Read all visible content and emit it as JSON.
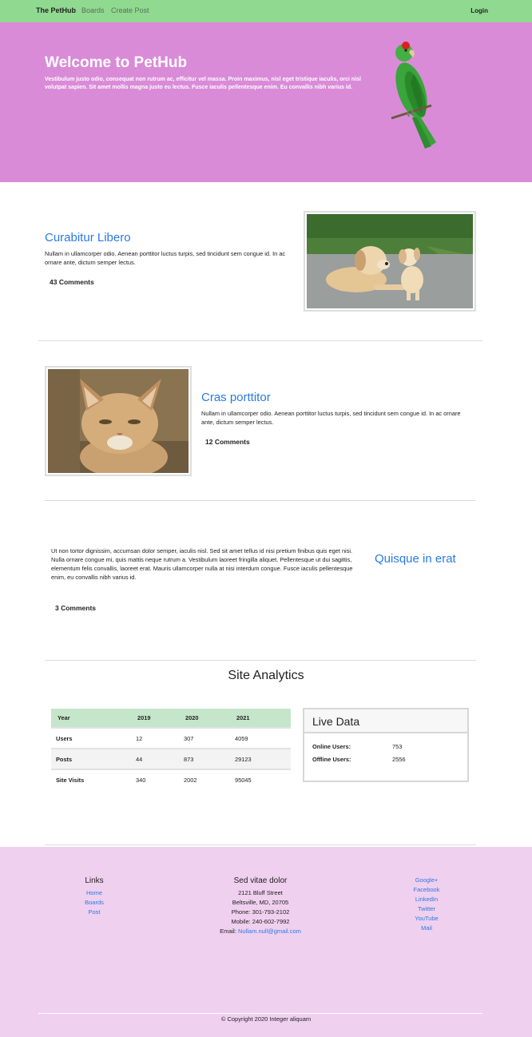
{
  "navbar": {
    "brand": "The PetHub",
    "links": [
      "Boards",
      "Create Post"
    ],
    "login": "Login"
  },
  "hero": {
    "title": "Welcome to PetHub",
    "text": "Vestibulum justo odio, consequat non rutrum ac, efficitur vel massa. Proin maximus, nisl eget tristique iaculis, orci nisl volutpat sapien. Sit amet mollis magna justo eu lectus. Fusce iaculis pellentesque enim. Eu convallis nibh varius id."
  },
  "posts": [
    {
      "title": "Curabitur Libero",
      "text": "Nullam in ullamcorper odio. Aenean porttitor luctus turpis, sed tincidunt sem congue id. In ac ornare ante, dictum semper lectus.",
      "comments": "43 Comments",
      "image": "dogs-photo"
    },
    {
      "title": "Cras porttitor",
      "text": "Nullam in ullamcorper odio. Aenean porttitor luctus turpis, sed tincidunt sem congue id. In ac ornare ante, dictum semper lectus.",
      "comments": "12 Comments",
      "image": "kitten-photo"
    },
    {
      "title": "Quisque in erat",
      "text": "Ut non tortor dignissim, accumsan dolor semper, iaculis nisl. Sed sit amet tellus id nisi pretium finibus quis eget nisi. Nulla ornare congue mi, quis mattis neque rutrum a. Vestibulum laoreet fringilla aliquet. Pellentesque ut dui sagittis, elementum felis convallis, laoreet erat. Mauris ullamcorper nulla at nisi interdum congue. Fusce iaculis pellentesque enim, eu convallis nibh varius id.",
      "comments": "3 Comments"
    }
  ],
  "analytics": {
    "title": "Site Analytics",
    "table": {
      "headers": [
        "Year",
        "2019",
        "2020",
        "2021"
      ],
      "rows": [
        [
          "Users",
          "12",
          "307",
          "4059"
        ],
        [
          "Posts",
          "44",
          "873",
          "29123"
        ],
        [
          "Site Visits",
          "340",
          "2002",
          "95045"
        ]
      ]
    },
    "live": {
      "title": "Live Data",
      "online_label": "Online Users:",
      "online_value": "753",
      "offline_label": "Offline Users:",
      "offline_value": "2556"
    }
  },
  "footer": {
    "links": {
      "title": "Links",
      "items": [
        "Home",
        "Boards",
        "Post"
      ]
    },
    "contact": {
      "title": "Sed vitae dolor",
      "street": "2121 Bluff Street",
      "city": "Beltsville, MD, 20705",
      "phone": "Phone: 301-793-2102",
      "mobile": "Mobile: 240-602-7992",
      "email_label": "Email: ",
      "email": "Nullam.null@gmail.com"
    },
    "social": [
      "Google+",
      "Facebook",
      "LinkedIn",
      "Twitter",
      "YouTube",
      "Mail"
    ],
    "copyright": "© Copyright 2020 Integer aliquam"
  },
  "colors": {
    "navbar": "#90d990",
    "hero": "#d98bd8",
    "accent": "#2a7ae2",
    "footer": "#f0d0ef"
  }
}
